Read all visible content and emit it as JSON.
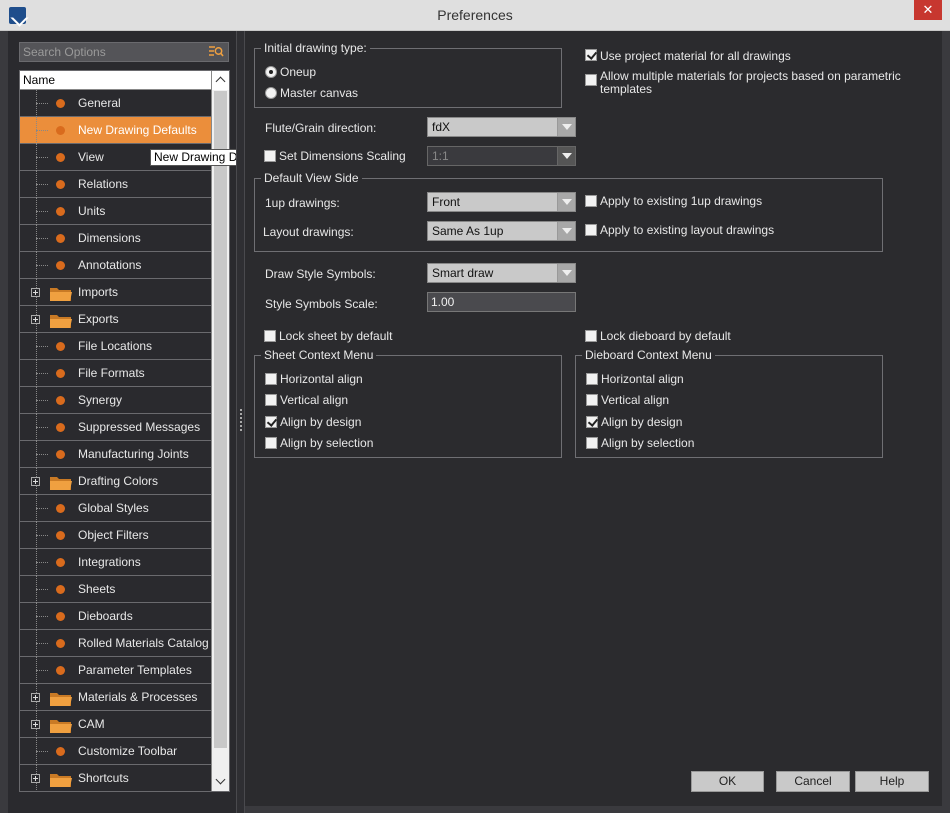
{
  "window": {
    "title": "Preferences",
    "close_glyph": "✕"
  },
  "search": {
    "placeholder": "Search Options"
  },
  "tree": {
    "header": "Name",
    "tooltip": "New Drawing Defaults",
    "items": [
      {
        "label": "General",
        "type": "leaf"
      },
      {
        "label": "New Drawing Defaults",
        "type": "leaf",
        "selected": true
      },
      {
        "label": "View",
        "type": "leaf"
      },
      {
        "label": "Relations",
        "type": "leaf"
      },
      {
        "label": "Units",
        "type": "leaf"
      },
      {
        "label": "Dimensions",
        "type": "leaf"
      },
      {
        "label": "Annotations",
        "type": "leaf"
      },
      {
        "label": "Imports",
        "type": "folder"
      },
      {
        "label": "Exports",
        "type": "folder"
      },
      {
        "label": "File Locations",
        "type": "leaf"
      },
      {
        "label": "File Formats",
        "type": "leaf"
      },
      {
        "label": "Synergy",
        "type": "leaf"
      },
      {
        "label": "Suppressed Messages",
        "type": "leaf"
      },
      {
        "label": "Manufacturing Joints",
        "type": "leaf"
      },
      {
        "label": "Drafting Colors",
        "type": "folder"
      },
      {
        "label": "Global Styles",
        "type": "leaf"
      },
      {
        "label": "Object Filters",
        "type": "leaf"
      },
      {
        "label": "Integrations",
        "type": "leaf"
      },
      {
        "label": "Sheets",
        "type": "leaf"
      },
      {
        "label": "Dieboards",
        "type": "leaf"
      },
      {
        "label": "Rolled Materials Catalog",
        "type": "leaf"
      },
      {
        "label": "Parameter Templates",
        "type": "leaf"
      },
      {
        "label": "Materials & Processes",
        "type": "folder"
      },
      {
        "label": "CAM",
        "type": "folder"
      },
      {
        "label": "Customize Toolbar",
        "type": "leaf"
      },
      {
        "label": "Shortcuts",
        "type": "folder"
      }
    ]
  },
  "settings": {
    "initial_drawing_type": {
      "title": "Initial drawing type:",
      "oneup": "Oneup",
      "master_canvas": "Master canvas",
      "selected": "Oneup"
    },
    "use_project_material": {
      "label": "Use project material for all drawings",
      "checked": true
    },
    "allow_multiple_materials": {
      "label_line1": "Allow multiple materials for projects based on parametric",
      "label_line2": "templates",
      "checked": false
    },
    "flute_grain": {
      "label": "Flute/Grain direction:",
      "value": "fdX"
    },
    "dimensions_scaling": {
      "label": "Set Dimensions Scaling",
      "value": "1:1",
      "checked": false
    },
    "default_view_side": {
      "title": "Default View Side",
      "oneup_label": "1up drawings:",
      "oneup_value": "Front",
      "oneup_apply": "Apply to existing 1up drawings",
      "layout_label": "Layout drawings:",
      "layout_value": "Same As 1up",
      "layout_apply": "Apply to existing layout drawings"
    },
    "draw_style_symbols": {
      "label": "Draw Style Symbols:",
      "value": "Smart draw"
    },
    "style_symbols_scale": {
      "label": "Style Symbols Scale:",
      "value": "1.00"
    },
    "lock_sheet": {
      "label": "Lock sheet by default",
      "checked": false
    },
    "lock_dieboard": {
      "label": "Lock dieboard by default",
      "checked": false
    },
    "sheet_context_menu": {
      "title": "Sheet Context Menu",
      "horizontal": "Horizontal align",
      "vertical": "Vertical align",
      "by_design": "Align by design",
      "by_selection": "Align by selection"
    },
    "dieboard_context_menu": {
      "title": "Dieboard Context Menu",
      "horizontal": "Horizontal align",
      "vertical": "Vertical align",
      "by_design": "Align by design",
      "by_selection": "Align by selection"
    }
  },
  "buttons": {
    "ok": "OK",
    "cancel": "Cancel",
    "help": "Help"
  },
  "colors": {
    "selected_row": "#eb8e3b",
    "bullet": "#d96b1d",
    "folder": "#f0a040",
    "close_button": "#c7372f"
  }
}
